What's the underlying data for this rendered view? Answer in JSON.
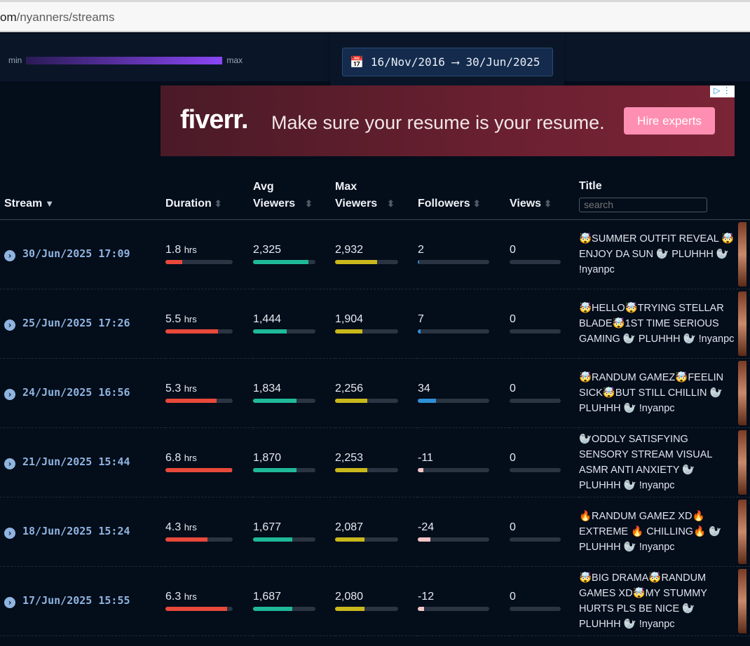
{
  "browser": {
    "url_host": "om",
    "url_path": "/nyanners/streams"
  },
  "legend": {
    "min": "min",
    "max": "max"
  },
  "date_range": {
    "start": "16/Nov/2016",
    "arrow": "⟶",
    "end": "30/Jun/2025"
  },
  "ad": {
    "logo": "fiverr.",
    "message": "Make sure your resume is your resume.",
    "cta": "Hire experts",
    "adchoices": "▷ ⋮"
  },
  "table": {
    "headers": {
      "stream": "Stream",
      "duration": "Duration",
      "avg": "Avg Viewers",
      "max": "Max Viewers",
      "followers": "Followers",
      "views": "Views",
      "title": "Title"
    },
    "search_placeholder": "search",
    "colors": {
      "duration": "#e8493a",
      "avg": "#1fb99a",
      "max": "#c9b81c",
      "followers_pos": "#2f8fd6",
      "followers_neg": "#f4c5c8"
    },
    "rows": [
      {
        "stream": "30/Jun/2025 17:09",
        "duration": "1.8",
        "unit": "hrs",
        "dur_frac": 0.25,
        "avg": "2,325",
        "avg_frac": 0.89,
        "max": "2,932",
        "max_frac": 0.67,
        "followers": "2",
        "fol_frac": 0.02,
        "fol_neg": false,
        "views": "0",
        "title": "🤯SUMMER OUTFIT REVEAL 🤯ENJOY DA SUN 🦭 PLUHHH 🦭 !nyanpc"
      },
      {
        "stream": "25/Jun/2025 17:26",
        "duration": "5.5",
        "unit": "hrs",
        "dur_frac": 0.78,
        "avg": "1,444",
        "avg_frac": 0.54,
        "max": "1,904",
        "max_frac": 0.43,
        "followers": "7",
        "fol_frac": 0.04,
        "fol_neg": false,
        "views": "0",
        "title": "🤯HELLO🤯TRYING STELLAR BLADE🤯1ST TIME SERIOUS GAMING 🦭 PLUHHH 🦭 !nyanpc"
      },
      {
        "stream": "24/Jun/2025 16:56",
        "duration": "5.3",
        "unit": "hrs",
        "dur_frac": 0.76,
        "avg": "1,834",
        "avg_frac": 0.7,
        "max": "2,256",
        "max_frac": 0.51,
        "followers": "34",
        "fol_frac": 0.25,
        "fol_neg": false,
        "views": "0",
        "title": "🤯RANDUM GAMEZ🤯FEELIN SICK🤯BUT STILL CHILLIN 🦭 PLUHHH 🦭 !nyanpc"
      },
      {
        "stream": "21/Jun/2025 15:44",
        "duration": "6.8",
        "unit": "hrs",
        "dur_frac": 0.99,
        "avg": "1,870",
        "avg_frac": 0.7,
        "max": "2,253",
        "max_frac": 0.51,
        "followers": "-11",
        "fol_frac": 0.08,
        "fol_neg": true,
        "views": "0",
        "title": "🦭ODDLY SATISFYING SENSORY STREAM VISUAL ASMR ANTI ANXIETY 🦭 PLUHHH 🦭 !nyanpc"
      },
      {
        "stream": "18/Jun/2025 15:24",
        "duration": "4.3",
        "unit": "hrs",
        "dur_frac": 0.63,
        "avg": "1,677",
        "avg_frac": 0.63,
        "max": "2,087",
        "max_frac": 0.47,
        "followers": "-24",
        "fol_frac": 0.18,
        "fol_neg": true,
        "views": "0",
        "title": "🔥RANDUM GAMEZ XD🔥 EXTREME 🔥 CHILLING🔥 🦭 PLUHHH 🦭 !nyanpc"
      },
      {
        "stream": "17/Jun/2025 15:55",
        "duration": "6.3",
        "unit": "hrs",
        "dur_frac": 0.92,
        "avg": "1,687",
        "avg_frac": 0.63,
        "max": "2,080",
        "max_frac": 0.47,
        "followers": "-12",
        "fol_frac": 0.09,
        "fol_neg": true,
        "views": "0",
        "title": "🤯BIG DRAMA🤯RANDUM GAMES XD🤯MY STUMMY HURTS PLS BE NICE 🦭 PLUHHH 🦭 !nyanpc"
      }
    ]
  }
}
